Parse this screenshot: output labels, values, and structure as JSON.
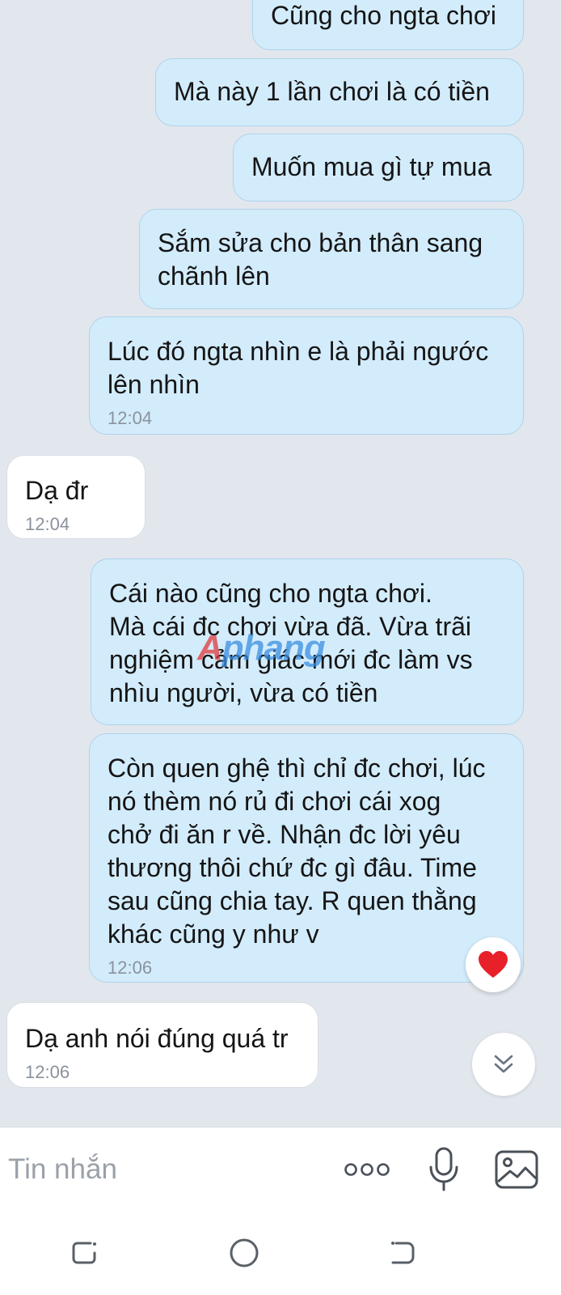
{
  "messages": [
    {
      "side": "sent",
      "lines": [
        "Cũng cho ngta chơi"
      ],
      "time": ""
    },
    {
      "side": "sent",
      "lines": [
        "Mà này 1 lần chơi là có tiền"
      ],
      "time": ""
    },
    {
      "side": "sent",
      "lines": [
        "Muốn mua gì tự mua"
      ],
      "time": ""
    },
    {
      "side": "sent",
      "lines": [
        "Sắm sửa cho bản thân sang",
        "chãnh lên"
      ],
      "time": ""
    },
    {
      "side": "sent",
      "lines": [
        "Lúc đó ngta nhìn e là phải ngước",
        "lên nhìn"
      ],
      "time": "12:04"
    },
    {
      "side": "recv",
      "lines": [
        "Dạ đr"
      ],
      "time": "12:04"
    },
    {
      "side": "sent",
      "lines": [
        "Cái nào cũng cho ngta chơi.",
        "Mà cái đc chơi vừa đã. Vừa trãi",
        "nghiệm cảm giác mới đc làm vs",
        "nhìu người, vừa có tiền"
      ],
      "time": ""
    },
    {
      "side": "sent",
      "lines": [
        "Còn quen ghệ thì chỉ đc chơi, lúc",
        "nó thèm nó rủ đi chơi cái xog",
        "chở đi ăn r về. Nhận đc lời yêu",
        "thương thôi chứ đc gì đâu. Time",
        "sau cũng chia tay. R quen thằng",
        "khác cũng y như v"
      ],
      "time": "12:06",
      "reaction": "heart-icon"
    },
    {
      "side": "recv",
      "lines": [
        "Dạ anh nói đúng quá tr"
      ],
      "time": "12:06"
    }
  ],
  "watermark": {
    "part1": "A",
    "part2": "phang"
  },
  "composer": {
    "placeholder": "Tin nhắn"
  },
  "icons": {
    "more": "more-dots-icon",
    "mic": "microphone-icon",
    "gallery": "image-gallery-icon",
    "reaction": "heart-icon",
    "scroll": "chevron-double-down-icon"
  },
  "colors": {
    "sent_bubble": "#d3ecfc",
    "recv_bubble": "#ffffff",
    "chat_background": "#e2e7ee",
    "reaction": "#e8202a"
  }
}
